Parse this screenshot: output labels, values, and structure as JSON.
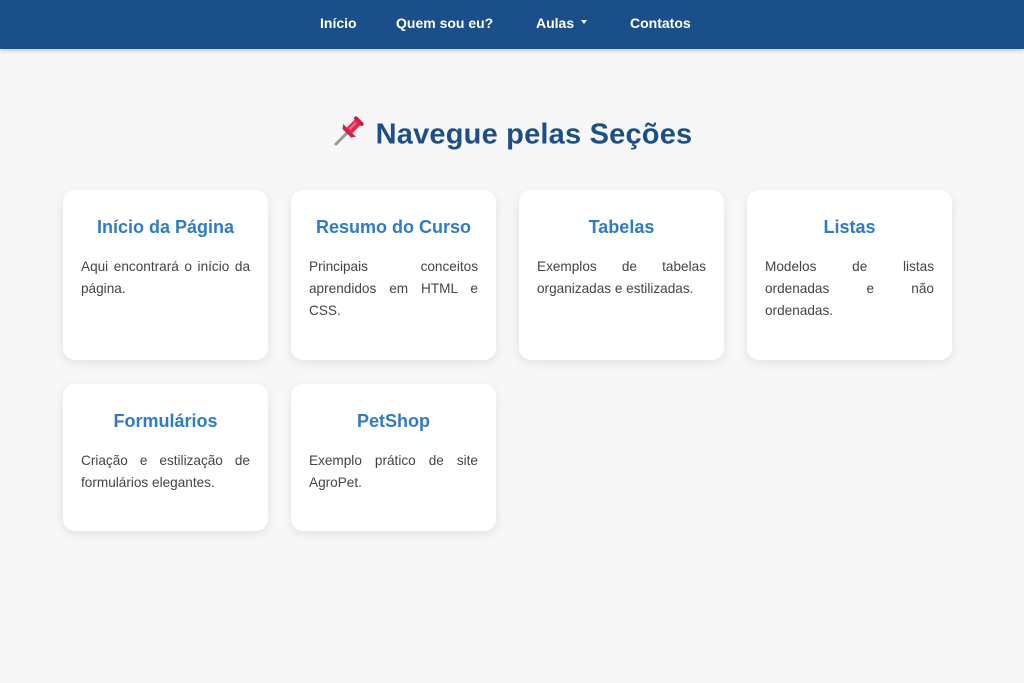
{
  "nav": {
    "items": [
      {
        "label": "Início"
      },
      {
        "label": "Quem sou eu?"
      },
      {
        "label": "Aulas",
        "has_dropdown": true
      },
      {
        "label": "Contatos"
      }
    ]
  },
  "main": {
    "heading_icon": "pushpin-icon",
    "heading": "Navegue pelas Seções",
    "cards": [
      {
        "title": "Início da Página",
        "description": "Aqui encontrará o início da página."
      },
      {
        "title": "Resumo do Curso",
        "description": "Principais conceitos aprendidos em HTML e CSS."
      },
      {
        "title": "Tabelas",
        "description": "Exemplos de tabelas organizadas e estilizadas."
      },
      {
        "title": "Listas",
        "description": "Modelos de listas ordenadas e não ordenadas."
      },
      {
        "title": "Formulários",
        "description": "Criação e estilização de formulários elegantes."
      },
      {
        "title": "PetShop",
        "description": "Exemplo prático de site AgroPet."
      }
    ]
  },
  "colors": {
    "navbar": "#1b4f8a",
    "heading": "#1d4f86",
    "card_title": "#2f7bc8",
    "background": "#f7f7f7"
  }
}
